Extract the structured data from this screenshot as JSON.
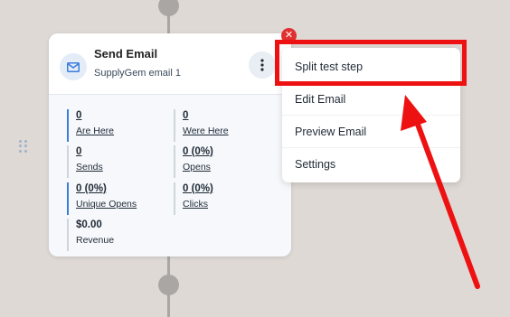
{
  "card": {
    "title": "Send Email",
    "subtitle": "SupplyGem email 1",
    "stats": [
      {
        "value": "0",
        "label": "Are Here"
      },
      {
        "value": "0",
        "label": "Were Here"
      },
      {
        "value": "0",
        "label": "Sends"
      },
      {
        "value": "0 (0%)",
        "label": "Opens"
      },
      {
        "value": "0 (0%)",
        "label": "Unique Opens"
      },
      {
        "value": "0 (0%)",
        "label": "Clicks"
      },
      {
        "value": "$0.00",
        "label": "Revenue"
      }
    ]
  },
  "menu": {
    "items": [
      "Split test step",
      "Edit Email",
      "Preview Email",
      "Settings"
    ]
  },
  "colors": {
    "background": "#ded9d5",
    "highlight": "#ee1111",
    "accent": "#3b7ddd",
    "close_badge": "#e03131"
  },
  "icons": [
    "email-icon",
    "kebab-menu-icon",
    "close-icon",
    "drag-handle-icon"
  ]
}
